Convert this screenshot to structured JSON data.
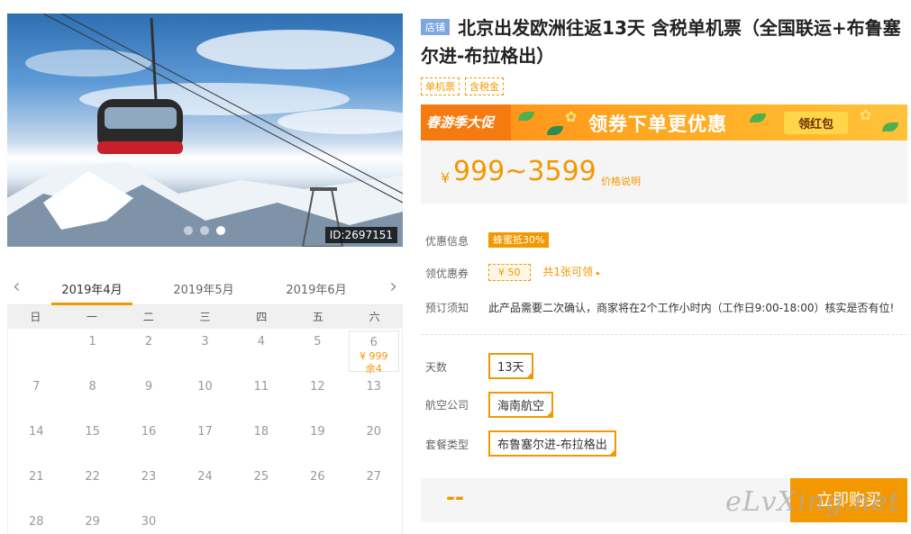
{
  "photo": {
    "id_label": "ID:2697151",
    "slides": 3,
    "active_slide": 3
  },
  "calendar": {
    "prev_icon": "chevron-left-icon",
    "next_icon": "chevron-right-icon",
    "months": [
      "2019年4月",
      "2019年5月",
      "2019年6月"
    ],
    "weekdays": [
      "日",
      "一",
      "二",
      "三",
      "四",
      "五",
      "六"
    ],
    "days": [
      [
        "",
        "1",
        "2",
        "3",
        "4",
        "5",
        "6"
      ],
      [
        "7",
        "8",
        "9",
        "10",
        "11",
        "12",
        "13"
      ],
      [
        "14",
        "15",
        "16",
        "17",
        "18",
        "19",
        "20"
      ],
      [
        "21",
        "22",
        "23",
        "24",
        "25",
        "26",
        "27"
      ],
      [
        "28",
        "29",
        "30",
        "",
        "",
        "",
        ""
      ]
    ],
    "available": {
      "day": "6",
      "price": "¥ 999",
      "remain": "余4"
    }
  },
  "product": {
    "shop_tag": "店铺",
    "title": "北京出发欧洲往返13天 含税单机票（全国联运+布鲁塞尔进-布拉格出）",
    "tags": [
      "单机票",
      "含税金"
    ],
    "banner": {
      "left": "春游季大促",
      "main": "领券下单更优惠",
      "button": "领红包"
    },
    "price": {
      "currency": "¥",
      "value": "999~3599",
      "note": "价格说明"
    },
    "info": {
      "discount_label": "优惠信息",
      "discount_badge": "蜂蜜抵30%",
      "coupon_label": "领优惠券",
      "coupon_value": "¥ 50",
      "coupon_link": "共1张可领",
      "notice_label": "预订须知",
      "notice_text": "此产品需要二次确认，商家将在2个工作小时内（工作日9:00-18:00）核实是否有位!"
    },
    "options": {
      "days_label": "天数",
      "days_value": "13天",
      "airline_label": "航空公司",
      "airline_value": "海南航空",
      "package_label": "套餐类型",
      "package_value": "布鲁塞尔进-布拉格出"
    },
    "buy": {
      "price": "--",
      "button": "立即购买",
      "watermark": "eLvXing.net"
    }
  },
  "colors": {
    "accent": "#f39800",
    "shop_tag": "#7ea6e0"
  }
}
